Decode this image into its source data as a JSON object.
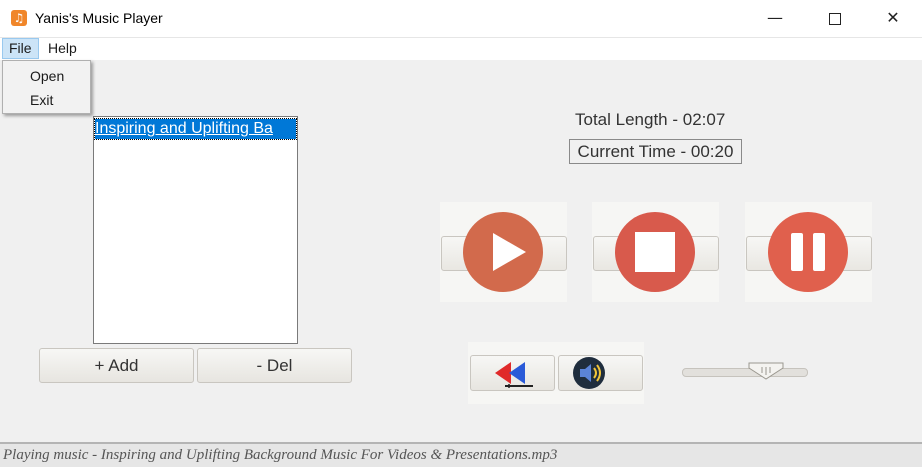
{
  "window": {
    "title": "Yanis's Music Player",
    "icon": "music-note-icon",
    "controls": {
      "minimize": "—",
      "close": "✕"
    }
  },
  "menu": {
    "file": "File",
    "help": "Help",
    "file_items": [
      "Open",
      "Exit"
    ]
  },
  "playlist": {
    "items": [
      "Inspiring and Uplifting Background Music For Videos & Presentations.mp3"
    ],
    "selected_display": "Inspiring and Uplifting Ba"
  },
  "buttons": {
    "add": "+ Add",
    "del": "- Del"
  },
  "time": {
    "total_length": "Total Length - 02:07",
    "current_time": "Current Time - 00:20"
  },
  "transport": {
    "play_icon": "play-icon",
    "stop_icon": "stop-icon",
    "pause_icon": "pause-icon",
    "rewind_icon": "rewind-icon",
    "volume_icon": "volume-icon"
  },
  "volume": {
    "level_fraction": 0.7
  },
  "status": {
    "text": "Playing music - Inspiring and Uplifting Background Music For Videos & Presentations.mp3"
  },
  "colors": {
    "play": "#d26a4c",
    "stop": "#d85a4c",
    "pause": "#e0604d",
    "selection": "#0078d7",
    "menu_highlight": "#cce4f7"
  }
}
